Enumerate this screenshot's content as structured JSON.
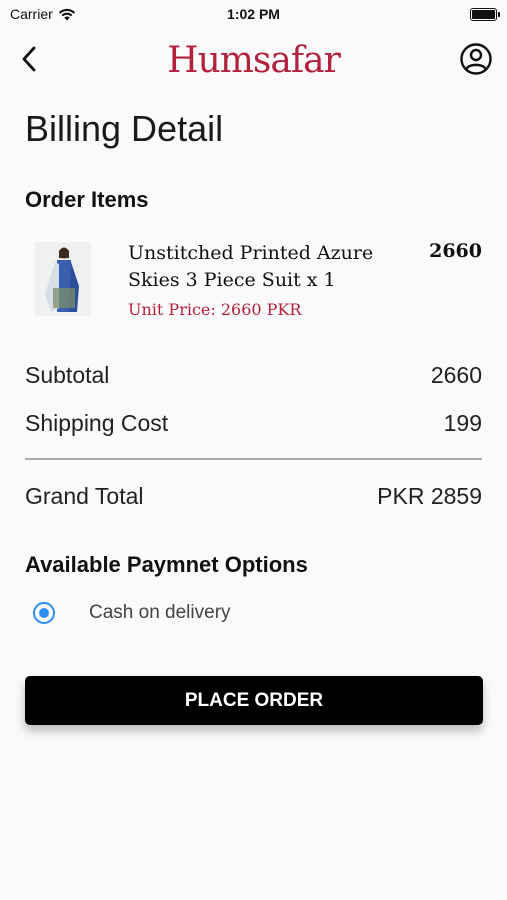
{
  "status_bar": {
    "carrier": "Carrier",
    "time": "1:02 PM"
  },
  "header": {
    "logo_text": "Humsafar",
    "brand_color": "#b4213c"
  },
  "page": {
    "title": "Billing Detail"
  },
  "order_items": {
    "title": "Order Items",
    "items": [
      {
        "name": "Unstitched Printed Azure Skies 3 Piece Suit x  1",
        "unit_price": "Unit Price: 2660 PKR",
        "total": "2660"
      }
    ]
  },
  "summary": {
    "subtotal_label": "Subtotal",
    "subtotal_value": "2660",
    "shipping_label": "Shipping Cost",
    "shipping_value": "199",
    "grand_label": "Grand Total",
    "grand_value": "PKR 2859"
  },
  "payment": {
    "title": "Available Paymnet Options",
    "options": [
      {
        "label": "Cash on delivery",
        "selected": true
      }
    ],
    "accent": "#2a8ff0"
  },
  "actions": {
    "place_order_label": "PLACE ORDER"
  }
}
